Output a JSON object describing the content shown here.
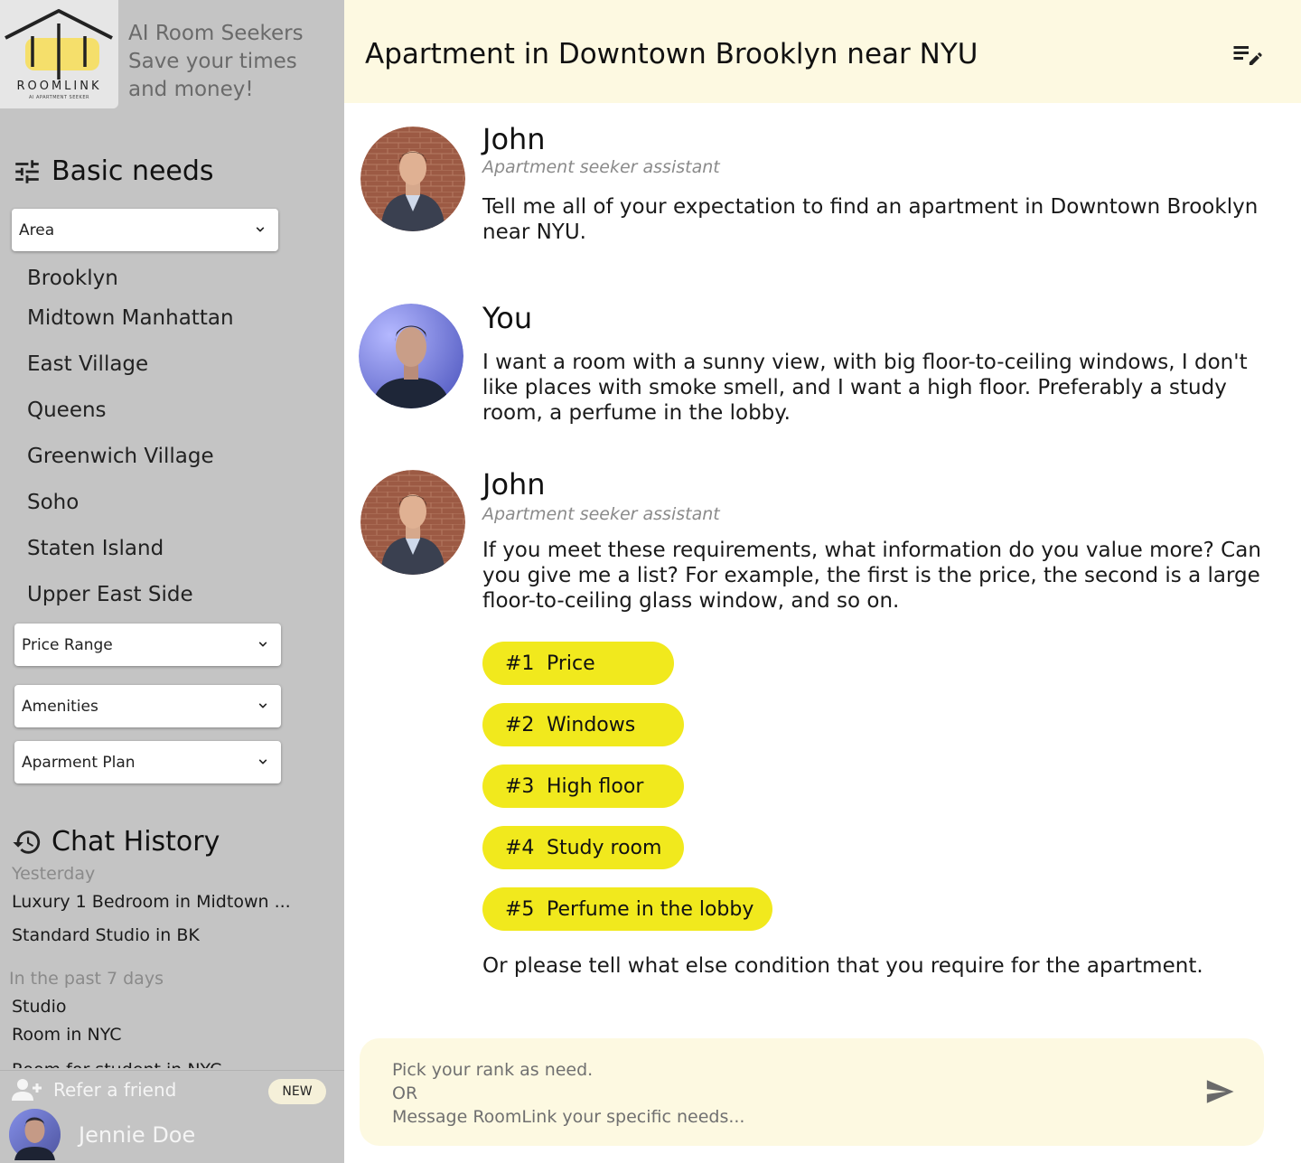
{
  "brand": {
    "logo_word": "ROOMLINK",
    "logo_sub": "AI APARTMENT SEEKER",
    "tagline_lines": [
      "AI Room Seekers",
      "Save your times",
      "and money!"
    ]
  },
  "basic_needs": {
    "title": "Basic needs",
    "area_select": "Area",
    "areas": [
      "Brooklyn",
      "Midtown Manhattan",
      "East Village",
      "Queens",
      "Greenwich Village",
      "Soho",
      "Staten Island",
      "Upper East Side"
    ],
    "price_select": "Price Range",
    "amenities_select": "Amenities",
    "plan_select": "Aparment Plan"
  },
  "chat_history": {
    "title": "Chat History",
    "groups": [
      {
        "label": "Yesterday",
        "items": [
          "Luxury 1 Bedroom in Midtown ...",
          "Standard Studio in BK"
        ]
      },
      {
        "label": "In the past 7 days",
        "items": [
          "Studio",
          "Room in NYC",
          "Room for student in NYC"
        ]
      }
    ]
  },
  "footer": {
    "refer_label": "Refer a friend",
    "new_badge": "NEW",
    "user_name": "Jennie Doe"
  },
  "header": {
    "title": "Apartment in Downtown Brooklyn near NYU"
  },
  "messages": [
    {
      "sender": "John",
      "role": "Apartment seeker assistant",
      "text": "Tell me all of your expectation to find an apartment in Downtown Brooklyn near NYU."
    },
    {
      "sender": "You",
      "text": "I want a room with a sunny view, with big floor-to-ceiling windows, I don't like places with smoke smell, and I want a high floor. Preferably a study room, a perfume in the lobby."
    },
    {
      "sender": "John",
      "role": "Apartment seeker assistant",
      "text": "If you meet these requirements, what information do you value more? Can you give me a list? For example, the first is the price, the second is a large floor-to-ceiling glass window, and so on.",
      "options": [
        {
          "rank": "#1",
          "label": "Price"
        },
        {
          "rank": "#2",
          "label": "Windows"
        },
        {
          "rank": "#3",
          "label": "High floor"
        },
        {
          "rank": "#4",
          "label": "Study room"
        },
        {
          "rank": "#5",
          "label": "Perfume in the lobby"
        }
      ],
      "followup": "Or please tell what else condition that you require for the apartment."
    }
  ],
  "composer": {
    "placeholder": "Pick your rank as need.\nOR\nMessage RoomLink your specific needs..."
  },
  "colors": {
    "sidebar": "#c4c4c4",
    "header": "#fdf9e1",
    "chip": "#f1e91d",
    "logo_yellow": "#f5df6b"
  },
  "icons": [
    "tune-icon",
    "history-icon",
    "add-person-icon",
    "edit-list-icon",
    "send-icon",
    "chevron-down-icon"
  ]
}
